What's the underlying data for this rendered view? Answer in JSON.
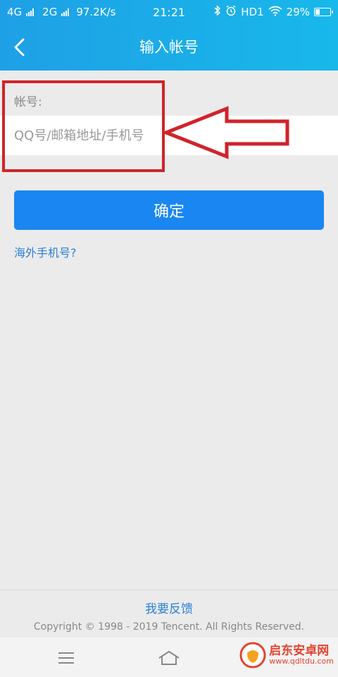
{
  "status_bar": {
    "network1": "4G",
    "network2": "2G",
    "speed": "97.2K/s",
    "time": "21:21",
    "hd": "HD1",
    "battery_percent": "29%",
    "battery_level": 0.29
  },
  "header": {
    "title": "输入帐号"
  },
  "form": {
    "account_label": "帐号:",
    "account_placeholder": "QQ号/邮箱地址/手机号",
    "account_value": "",
    "confirm_label": "确定",
    "overseas_link": "海外手机号?"
  },
  "footer": {
    "feedback_link": "我要反馈",
    "copyright": "Copyright © 1998 - 2019 Tencent. All Rights Reserved."
  },
  "watermark": {
    "title": "启东安卓网",
    "url": "www.qdltdu.com"
  },
  "colors": {
    "header_bg": "#1ea0e6",
    "accent": "#1a86f1",
    "annotation": "#d1232a"
  }
}
